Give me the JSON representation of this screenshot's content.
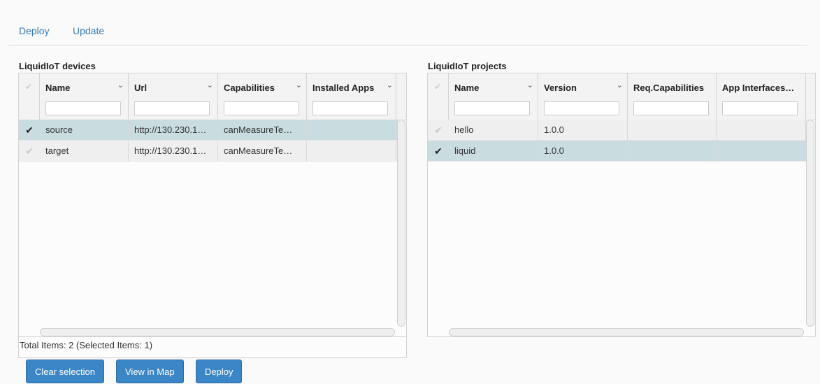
{
  "nav": {
    "tab_deploy": "Deploy",
    "tab_update": "Update"
  },
  "devices": {
    "title": "LiquidIoT devices",
    "columns": [
      "Name",
      "Url",
      "Capabilities",
      "Installed Apps"
    ],
    "rows": [
      {
        "selected": true,
        "name": "source",
        "url": "http://130.230.1…",
        "capabilities": "canMeasureTe…",
        "installed": ""
      },
      {
        "selected": false,
        "name": "target",
        "url": "http://130.230.1…",
        "capabilities": "canMeasureTe…",
        "installed": ""
      }
    ],
    "footer": "Total Items: 2 (Selected Items: 1)"
  },
  "projects": {
    "title": "LiquidIoT projects",
    "columns": [
      "Name",
      "Version",
      "Req.Capabilities",
      "App Interfaces…"
    ],
    "rows": [
      {
        "selected": false,
        "name": "hello",
        "version": "1.0.0"
      },
      {
        "selected": true,
        "name": "liquid",
        "version": "1.0.0"
      }
    ]
  },
  "buttons": {
    "clear": "Clear selection",
    "map": "View in Map",
    "deploy": "Deploy"
  },
  "icons": {
    "check": "✔",
    "menu": "⌄"
  },
  "colors": {
    "accent": "#337ab7",
    "button": "#3b86c6",
    "selected_row": "#c9dde1"
  }
}
